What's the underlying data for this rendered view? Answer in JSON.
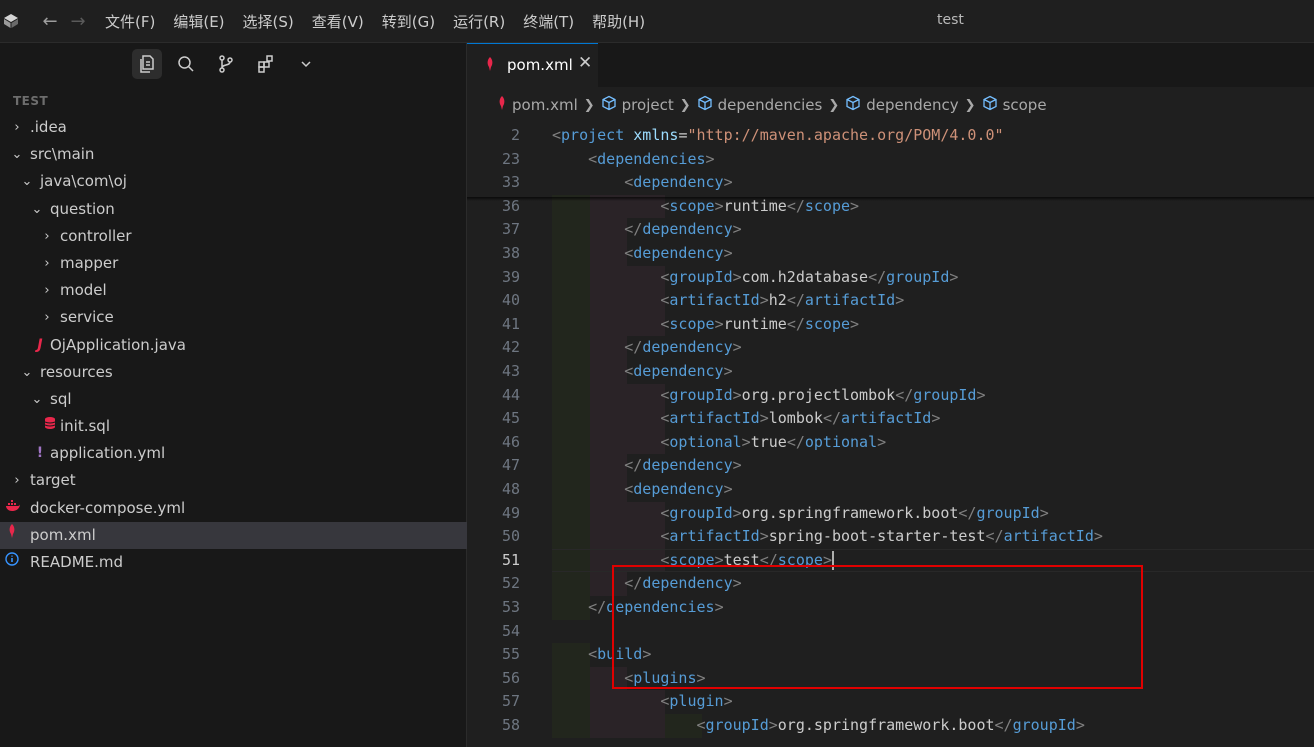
{
  "titlebar": {
    "menu": [
      "文件(F)",
      "编辑(E)",
      "选择(S)",
      "查看(V)",
      "转到(G)",
      "运行(R)",
      "终端(T)",
      "帮助(H)"
    ],
    "title": "test"
  },
  "explorer": {
    "section_title": "TEST",
    "items": [
      {
        "label": ".idea",
        "depth": 0,
        "chevron": "›",
        "icon": ""
      },
      {
        "label": "src\\main",
        "depth": 0,
        "chevron": "⌄",
        "icon": ""
      },
      {
        "label": "java\\com\\oj",
        "depth": 1,
        "chevron": "⌄",
        "icon": ""
      },
      {
        "label": "question",
        "depth": 2,
        "chevron": "⌄",
        "icon": ""
      },
      {
        "label": "controller",
        "depth": 3,
        "chevron": "›",
        "icon": ""
      },
      {
        "label": "mapper",
        "depth": 3,
        "chevron": "›",
        "icon": ""
      },
      {
        "label": "model",
        "depth": 3,
        "chevron": "›",
        "icon": ""
      },
      {
        "label": "service",
        "depth": 3,
        "chevron": "›",
        "icon": ""
      },
      {
        "label": "OjApplication.java",
        "depth": 2,
        "chevron": "",
        "icon": "java-icon"
      },
      {
        "label": "resources",
        "depth": 1,
        "chevron": "⌄",
        "icon": ""
      },
      {
        "label": "sql",
        "depth": 2,
        "chevron": "⌄",
        "icon": ""
      },
      {
        "label": "init.sql",
        "depth": 3,
        "chevron": "",
        "icon": "database-icon"
      },
      {
        "label": "application.yml",
        "depth": 2,
        "chevron": "",
        "icon": "yaml-icon"
      },
      {
        "label": "target",
        "depth": 0,
        "chevron": "›",
        "icon": ""
      },
      {
        "label": "docker-compose.yml",
        "depth": 0,
        "chevron": "",
        "icon": "docker-icon"
      },
      {
        "label": "pom.xml",
        "depth": 0,
        "chevron": "",
        "icon": "maven-icon",
        "selected": true
      },
      {
        "label": "README.md",
        "depth": 0,
        "chevron": "",
        "icon": "info-icon"
      }
    ]
  },
  "editor": {
    "tab": {
      "label": "pom.xml",
      "close": "✕"
    },
    "breadcrumb": [
      "pom.xml",
      "project",
      "dependencies",
      "dependency",
      "scope"
    ],
    "current_line": "51",
    "lines": [
      {
        "n": "2",
        "text": "<project xmlns=\"http://maven.apache.org/POM/4.0.0\""
      },
      {
        "n": "23",
        "text": "    <dependencies>"
      },
      {
        "n": "33",
        "text": "        <dependency>"
      },
      {
        "n": "36",
        "text": "            <scope>runtime</scope>"
      },
      {
        "n": "37",
        "text": "        </dependency>"
      },
      {
        "n": "38",
        "text": "        <dependency>"
      },
      {
        "n": "39",
        "text": "            <groupId>com.h2database</groupId>"
      },
      {
        "n": "40",
        "text": "            <artifactId>h2</artifactId>"
      },
      {
        "n": "41",
        "text": "            <scope>runtime</scope>"
      },
      {
        "n": "42",
        "text": "        </dependency>"
      },
      {
        "n": "43",
        "text": "        <dependency>"
      },
      {
        "n": "44",
        "text": "            <groupId>org.projectlombok</groupId>"
      },
      {
        "n": "45",
        "text": "            <artifactId>lombok</artifactId>"
      },
      {
        "n": "46",
        "text": "            <optional>true</optional>"
      },
      {
        "n": "47",
        "text": "        </dependency>"
      },
      {
        "n": "48",
        "text": "        <dependency>"
      },
      {
        "n": "49",
        "text": "            <groupId>org.springframework.boot</groupId>"
      },
      {
        "n": "50",
        "text": "            <artifactId>spring-boot-starter-test</artifactId>"
      },
      {
        "n": "51",
        "text": "            <scope>test</scope>"
      },
      {
        "n": "52",
        "text": "        </dependency>"
      },
      {
        "n": "53",
        "text": "    </dependencies>"
      },
      {
        "n": "54",
        "text": ""
      },
      {
        "n": "55",
        "text": "    <build>"
      },
      {
        "n": "56",
        "text": "        <plugins>"
      },
      {
        "n": "57",
        "text": "            <plugin>"
      },
      {
        "n": "58",
        "text": "                <groupId>org.springframework.boot</groupId>"
      }
    ]
  },
  "colors": {
    "accent": "#0078d4",
    "highlight_box": "#e00000",
    "tag": "#569cd6",
    "attribute": "#9cdcfe",
    "string": "#ce9178"
  }
}
